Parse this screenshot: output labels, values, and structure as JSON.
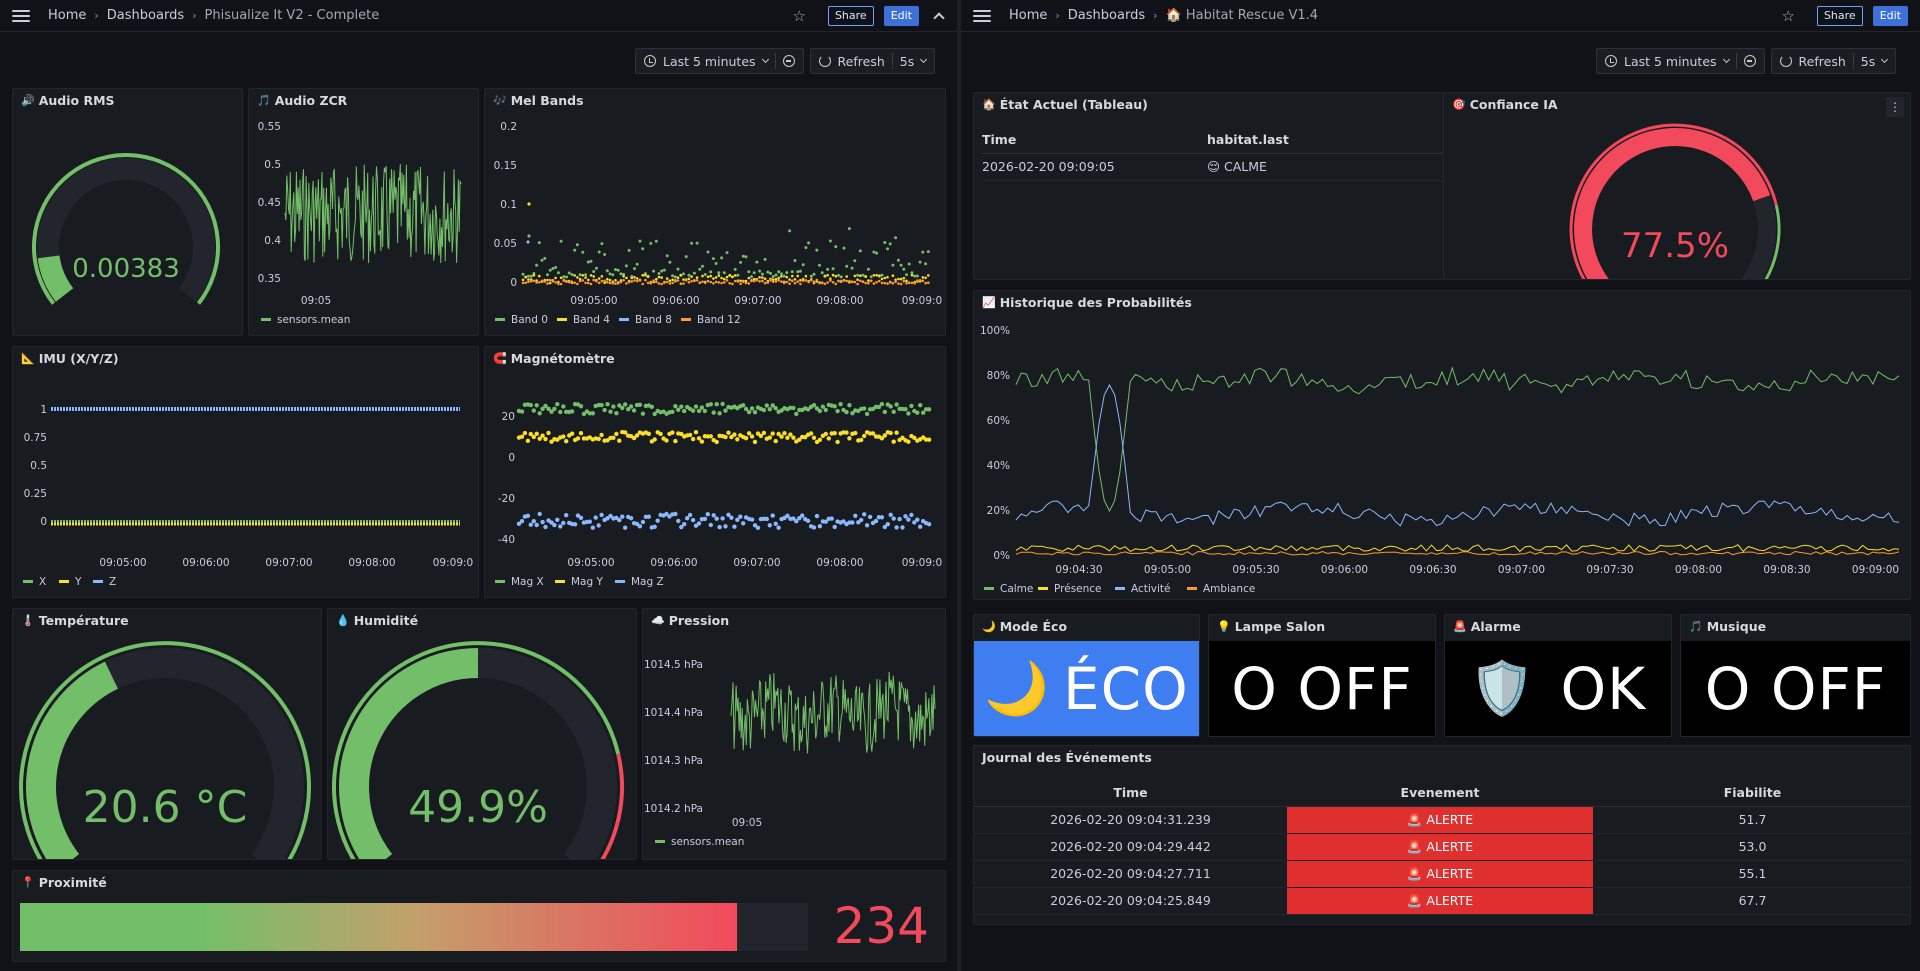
{
  "left": {
    "breadcrumb": {
      "home": "Home",
      "dashboards": "Dashboards",
      "title": "Phisualize It V2 - Complete"
    },
    "share_label": "Share",
    "edit_label": "Edit",
    "time_range": "Last 5 minutes",
    "refresh_label": "Refresh",
    "refresh_interval": "5s",
    "panels": {
      "audio_rms": {
        "title": "Audio RMS",
        "icon": "🔊",
        "value": "0.00383",
        "fraction": 0.12
      },
      "audio_zcr": {
        "title": "Audio ZCR",
        "icon": "🎵",
        "yticks": [
          "0.55",
          "0.5",
          "0.45",
          "0.4",
          "0.35"
        ],
        "xticks": [
          "09:05"
        ],
        "legend": [
          "sensors.mean"
        ]
      },
      "mel_bands": {
        "title": "Mel Bands",
        "icon": "🎶",
        "yticks": [
          "0.2",
          "0.15",
          "0.1",
          "0.05",
          "0"
        ],
        "xticks": [
          "09:05:00",
          "09:06:00",
          "09:07:00",
          "09:08:00",
          "09:09:0"
        ],
        "legend": [
          "Band 0",
          "Band 4",
          "Band 8",
          "Band 12"
        ]
      },
      "imu": {
        "title": "IMU (X/Y/Z)",
        "icon": "📐",
        "yticks": [
          "1",
          "0.75",
          "0.5",
          "0.25",
          "0"
        ],
        "xticks": [
          "09:05:00",
          "09:06:00",
          "09:07:00",
          "09:08:00",
          "09:09:0"
        ],
        "legend": [
          "X",
          "Y",
          "Z"
        ]
      },
      "magneto": {
        "title": "Magnétomètre",
        "icon": "🧲",
        "yticks": [
          "20",
          "0",
          "-20",
          "-40"
        ],
        "xticks": [
          "09:05:00",
          "09:06:00",
          "09:07:00",
          "09:08:00",
          "09:09:0"
        ],
        "legend": [
          "Mag X",
          "Mag Y",
          "Mag Z"
        ]
      },
      "temperature": {
        "title": "Température",
        "icon": "🌡️",
        "value": "20.6 °C",
        "fraction": 0.4
      },
      "humidity": {
        "title": "Humidité",
        "icon": "💧",
        "value": "49.9%",
        "fraction": 0.5
      },
      "pression": {
        "title": "Pression",
        "icon": "☁️",
        "yticks": [
          "1014.5 hPa",
          "1014.4 hPa",
          "1014.3 hPa",
          "1014.2 hPa"
        ],
        "xticks": [
          "09:05"
        ],
        "legend": [
          "sensors.mean"
        ]
      },
      "proximite": {
        "title": "Proximité",
        "icon": "📍",
        "value": "234",
        "fraction": 0.91
      }
    }
  },
  "right": {
    "breadcrumb": {
      "home": "Home",
      "dashboards": "Dashboards",
      "title": "🏠 Habitat Rescue V1.4"
    },
    "share_label": "Share",
    "edit_label": "Edit",
    "time_range": "Last 5 minutes",
    "refresh_label": "Refresh",
    "refresh_interval": "5s",
    "etat": {
      "title": "État Actuel (Tableau)",
      "icon": "🏠",
      "col_time": "Time",
      "col_value": "habitat.last",
      "row_time": "2026-02-20 09:09:05",
      "row_value": "😌 CALME"
    },
    "confiance": {
      "title": "Confiance IA",
      "icon": "🎯",
      "value": "77.5%",
      "fraction": 0.775
    },
    "historique": {
      "title": "Historique des Probabilités",
      "icon": "📈",
      "yticks": [
        "100%",
        "80%",
        "60%",
        "40%",
        "20%",
        "0%"
      ],
      "xticks": [
        "09:04:30",
        "09:05:00",
        "09:05:30",
        "09:06:00",
        "09:06:30",
        "09:07:00",
        "09:07:30",
        "09:08:00",
        "09:08:30",
        "09:09:00"
      ],
      "legend": [
        "Calme",
        "Présence",
        "Activité",
        "Ambiance"
      ]
    },
    "mode_eco": {
      "title": "Mode Éco",
      "icon": "🌙",
      "emoji": "🌙",
      "text": "ÉCO"
    },
    "lampe": {
      "title": "Lampe Salon",
      "icon": "💡",
      "text": "O OFF"
    },
    "alarme": {
      "title": "Alarme",
      "icon": "🚨",
      "emoji": "🛡️",
      "text": "OK"
    },
    "musique": {
      "title": "Musique",
      "icon": "🎵",
      "text": "O OFF"
    },
    "journal": {
      "title": "Journal des Événements",
      "columns": [
        "Time",
        "Evenement",
        "Fiabilite"
      ],
      "rows": [
        {
          "time": "2026-02-20 09:04:31.239",
          "event": "🚨 ALERTE",
          "fiab": "51.7"
        },
        {
          "time": "2026-02-20 09:04:29.442",
          "event": "🚨 ALERTE",
          "fiab": "53.0"
        },
        {
          "time": "2026-02-20 09:04:27.711",
          "event": "🚨 ALERTE",
          "fiab": "55.1"
        },
        {
          "time": "2026-02-20 09:04:25.849",
          "event": "🚨 ALERTE",
          "fiab": "67.7"
        }
      ]
    }
  },
  "colors": {
    "green": "#73bf69",
    "yellow": "#fade2a",
    "blue": "#8ab8ff",
    "orange": "#ff9830",
    "red": "#f2495c",
    "panel": "#181b1f"
  }
}
